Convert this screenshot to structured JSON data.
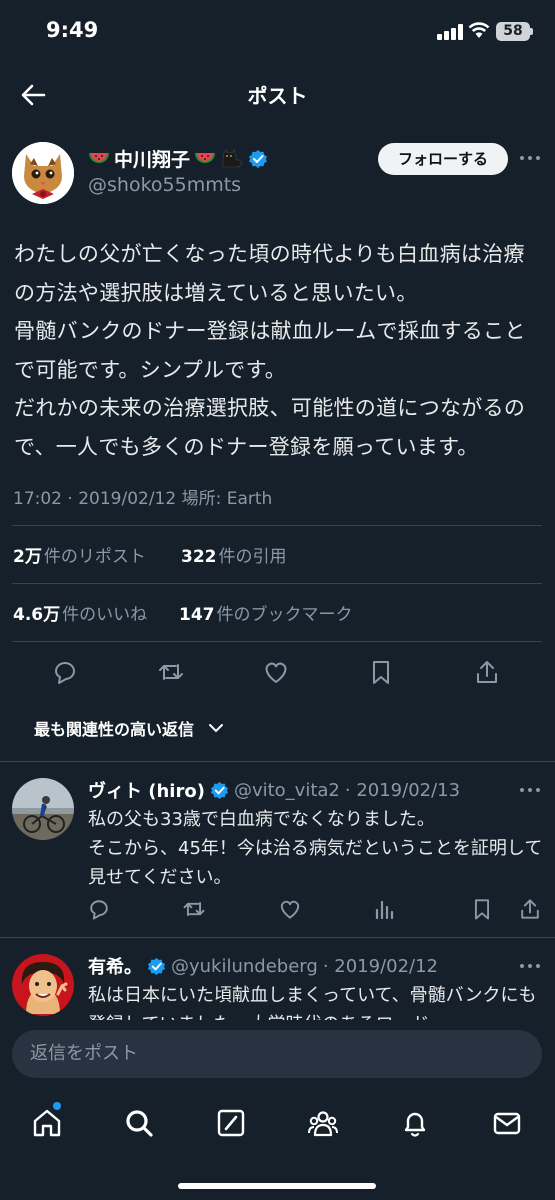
{
  "status": {
    "time": "9:49",
    "battery": "58"
  },
  "header": {
    "title": "ポスト"
  },
  "post": {
    "author_name": "中川翔子",
    "author_emojis": [
      "watermelon",
      "watermelon",
      "cat"
    ],
    "handle": "@shoko55mmts",
    "follow_label": "フォローする",
    "body": "わたしの父が亡くなった頃の時代よりも白血病は治療の方法や選択肢は増えていると思いたい。\n骨髄バンクのドナー登録は献血ルームで採血することで可能です。シンプルです。\nだれかの未来の治療選択肢、可能性の道につながるので、一人でも多くのドナー登録を願っています。",
    "meta": "17:02 · 2019/02/12 場所: Earth",
    "stats": {
      "reposts_value": "2万",
      "reposts_label": "件のリポスト",
      "quotes_value": "322",
      "quotes_label": "件の引用",
      "likes_value": "4.6万",
      "likes_label": "件のいいね",
      "bookmarks_value": "147",
      "bookmarks_label": "件のブックマーク"
    }
  },
  "sort_label": "最も関連性の高い返信",
  "replies": [
    {
      "name": "ヴィト (hiro)",
      "handle": "@vito_vita2",
      "date": "· 2019/02/13",
      "text": "私の父も33歳で白血病でなくなりました。\nそこから、45年！今は治る病気だということを証明して見せてください。"
    },
    {
      "name": "有希。",
      "handle": "@yukilundeberg",
      "date": "· 2019/02/12",
      "text": "私は日本にいた頃献血しまくっていて、骨髄バンクにも登録していました。大学時代のあるロード"
    }
  ],
  "composer": {
    "placeholder": "返信をポスト"
  },
  "colors": {
    "background": "#15202b",
    "verified": "#1d9bf0",
    "notification_dot": "#1d9bf0",
    "muted_text": "#8b98a5"
  },
  "icons": [
    "back-arrow-icon",
    "verified-badge-icon",
    "reply-icon",
    "repost-icon",
    "like-icon",
    "bookmark-icon",
    "share-icon",
    "analytics-icon",
    "home-icon",
    "search-icon",
    "grok-icon",
    "communities-icon",
    "notifications-icon",
    "messages-icon"
  ]
}
